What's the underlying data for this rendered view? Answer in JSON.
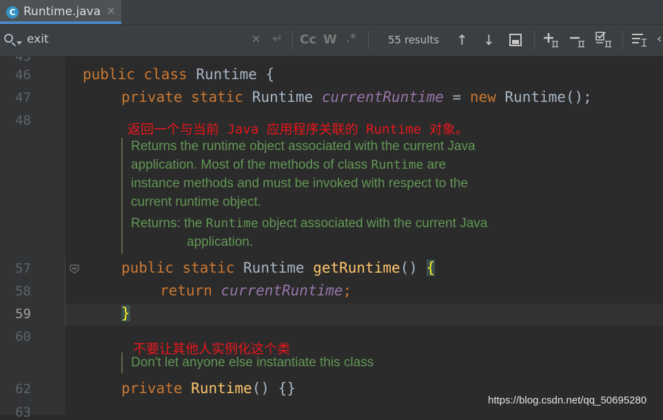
{
  "tab": {
    "icon_letter": "C",
    "file_name": "Runtime.java",
    "close": "×"
  },
  "search": {
    "query": "exit",
    "clear": "×",
    "newline": "↵",
    "match_case": "Cc",
    "words": "W",
    "regex": ".*",
    "results": "55 results",
    "prev": "↑",
    "next": "↓"
  },
  "line_numbers": [
    "46",
    "47",
    "48",
    "57",
    "58",
    "59",
    "60",
    "62",
    "63"
  ],
  "code": {
    "l46": {
      "kw1": "public",
      "kw2": "class",
      "name": "Runtime",
      "rest": " {"
    },
    "l47": {
      "kw1": "private",
      "kw2": "static",
      "type": "Runtime",
      "field": "currentRuntime",
      "eq": " = ",
      "kw3": "new",
      "call": " Runtime();"
    },
    "l57": {
      "kw1": "public",
      "kw2": "static",
      "type": "Runtime",
      "fn": "getRuntime",
      "parens": "() ",
      "brace": "{"
    },
    "l58": {
      "kw": "return",
      "field": "currentRuntime",
      "semi": ";"
    },
    "l59": {
      "brace": "}"
    },
    "l62": {
      "kw": "private",
      "fn": "Runtime",
      "rest": "() {}"
    }
  },
  "translation1": "返回一个与当前 Java 应用程序关联的 Runtime 对象。",
  "doc1": {
    "line1": "Returns the runtime object associated with the current Java",
    "line2a": "application. Most of the methods of class ",
    "line2code": "Runtime",
    "line2b": " are",
    "line3": "instance methods and must be invoked with respect to the",
    "line4": "current runtime object.",
    "returns_label": "Returns:",
    "returns_a": " the ",
    "returns_code": "Runtime",
    "returns_b": " object associated with the current Java",
    "returns_line2": "application."
  },
  "translation2": "不要让其他人实例化这个类",
  "doc2": "Don't let anyone else instantiate this class",
  "watermark": "https://blog.csdn.net/qq_50695280"
}
